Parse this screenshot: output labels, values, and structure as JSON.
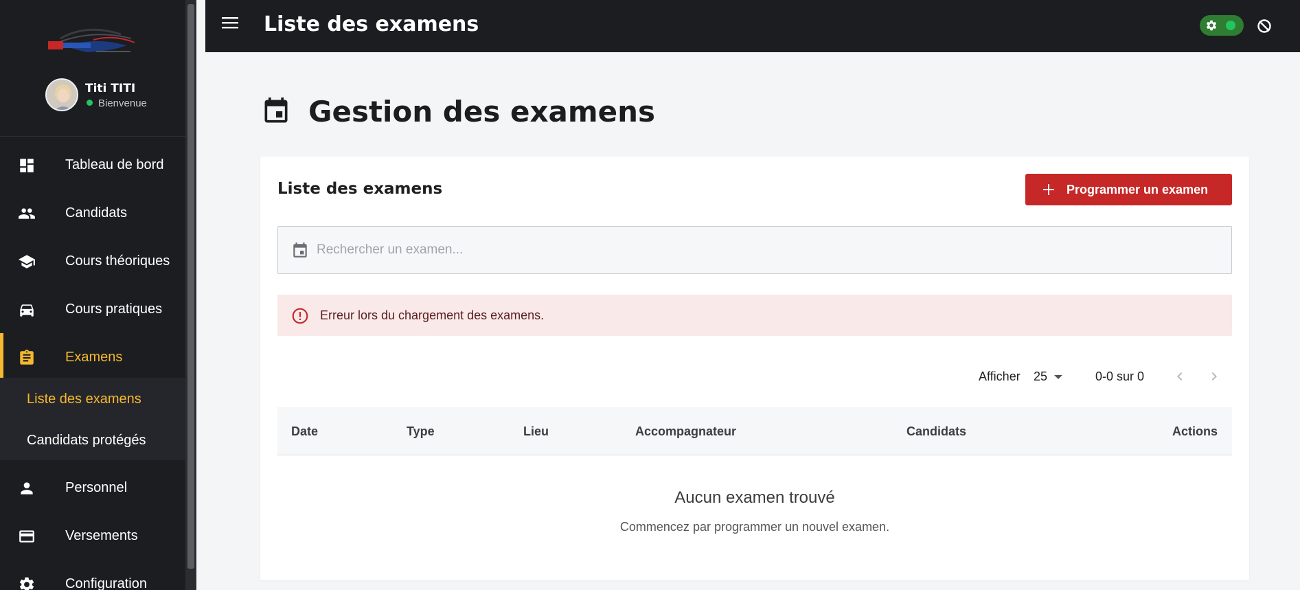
{
  "sidebar": {
    "user": {
      "name": "Titi TITI",
      "status": "Bienvenue"
    },
    "items": [
      {
        "label": "Tableau de bord",
        "icon": "dashboard-icon"
      },
      {
        "label": "Candidats",
        "icon": "people-icon"
      },
      {
        "label": "Cours théoriques",
        "icon": "school-icon"
      },
      {
        "label": "Cours pratiques",
        "icon": "car-icon"
      },
      {
        "label": "Examens",
        "icon": "clipboard-icon",
        "active": true
      },
      {
        "label": "Personnel",
        "icon": "person-icon"
      },
      {
        "label": "Versements",
        "icon": "credit-card-icon"
      },
      {
        "label": "Configuration",
        "icon": "gear-icon"
      }
    ],
    "submenu": [
      {
        "label": "Liste des examens",
        "active": true
      },
      {
        "label": "Candidats protégés"
      }
    ]
  },
  "topbar": {
    "title": "Liste des examens"
  },
  "main": {
    "page_title": "Gestion des examens",
    "card": {
      "title": "Liste des examens",
      "add_button": "Programmer un examen",
      "search_placeholder": "Rechercher un examen...",
      "error": "Erreur lors du chargement des examens.",
      "pagination": {
        "show_label": "Afficher",
        "per_page": "25",
        "range": "0-0 sur 0"
      },
      "columns": [
        "Date",
        "Type",
        "Lieu",
        "Accompagnateur",
        "Candidats",
        "Actions"
      ],
      "empty_title": "Aucun examen trouvé",
      "empty_subtitle": "Commencez par programmer un nouvel examen."
    }
  },
  "colors": {
    "accent": "#f5b82e",
    "primary_button": "#c62828",
    "sidebar_bg": "#1c1d21",
    "error_bg": "#f9e9e9",
    "status_online": "#22c55e"
  }
}
